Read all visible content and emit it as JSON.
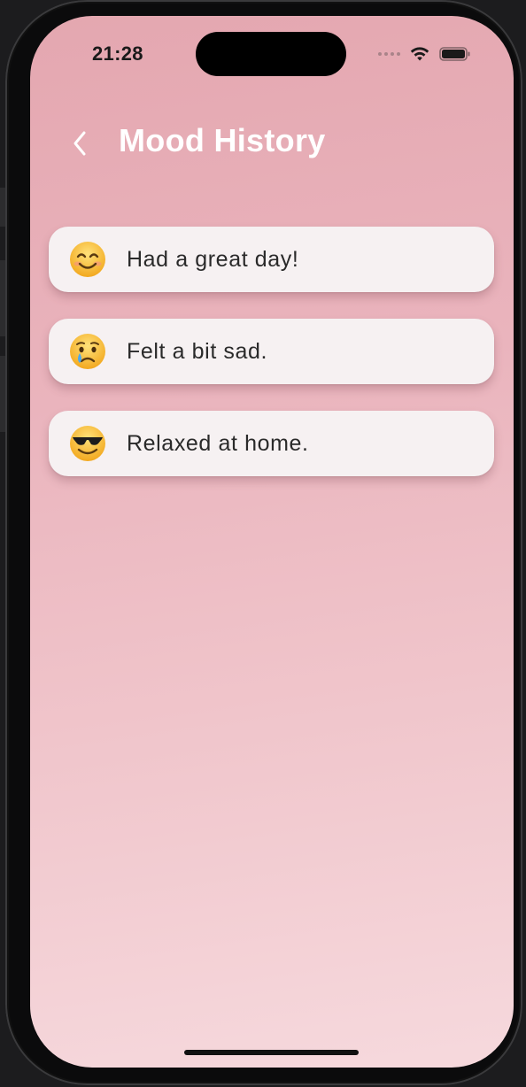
{
  "status_bar": {
    "time": "21:28"
  },
  "header": {
    "back_icon": "chevron-left-icon",
    "title": "Mood History"
  },
  "moods": [
    {
      "emoji": "smiling-face-icon",
      "note": "Had a great day!"
    },
    {
      "emoji": "crying-face-icon",
      "note": "Felt a bit sad."
    },
    {
      "emoji": "sunglasses-face-icon",
      "note": "Relaxed at home."
    }
  ],
  "colors": {
    "gradient_top": "#e4a7b0",
    "gradient_bottom": "#f6d9dd",
    "card_bg": "#f6f1f2",
    "title_color": "#ffffff",
    "text_color": "#2a2a2a"
  }
}
